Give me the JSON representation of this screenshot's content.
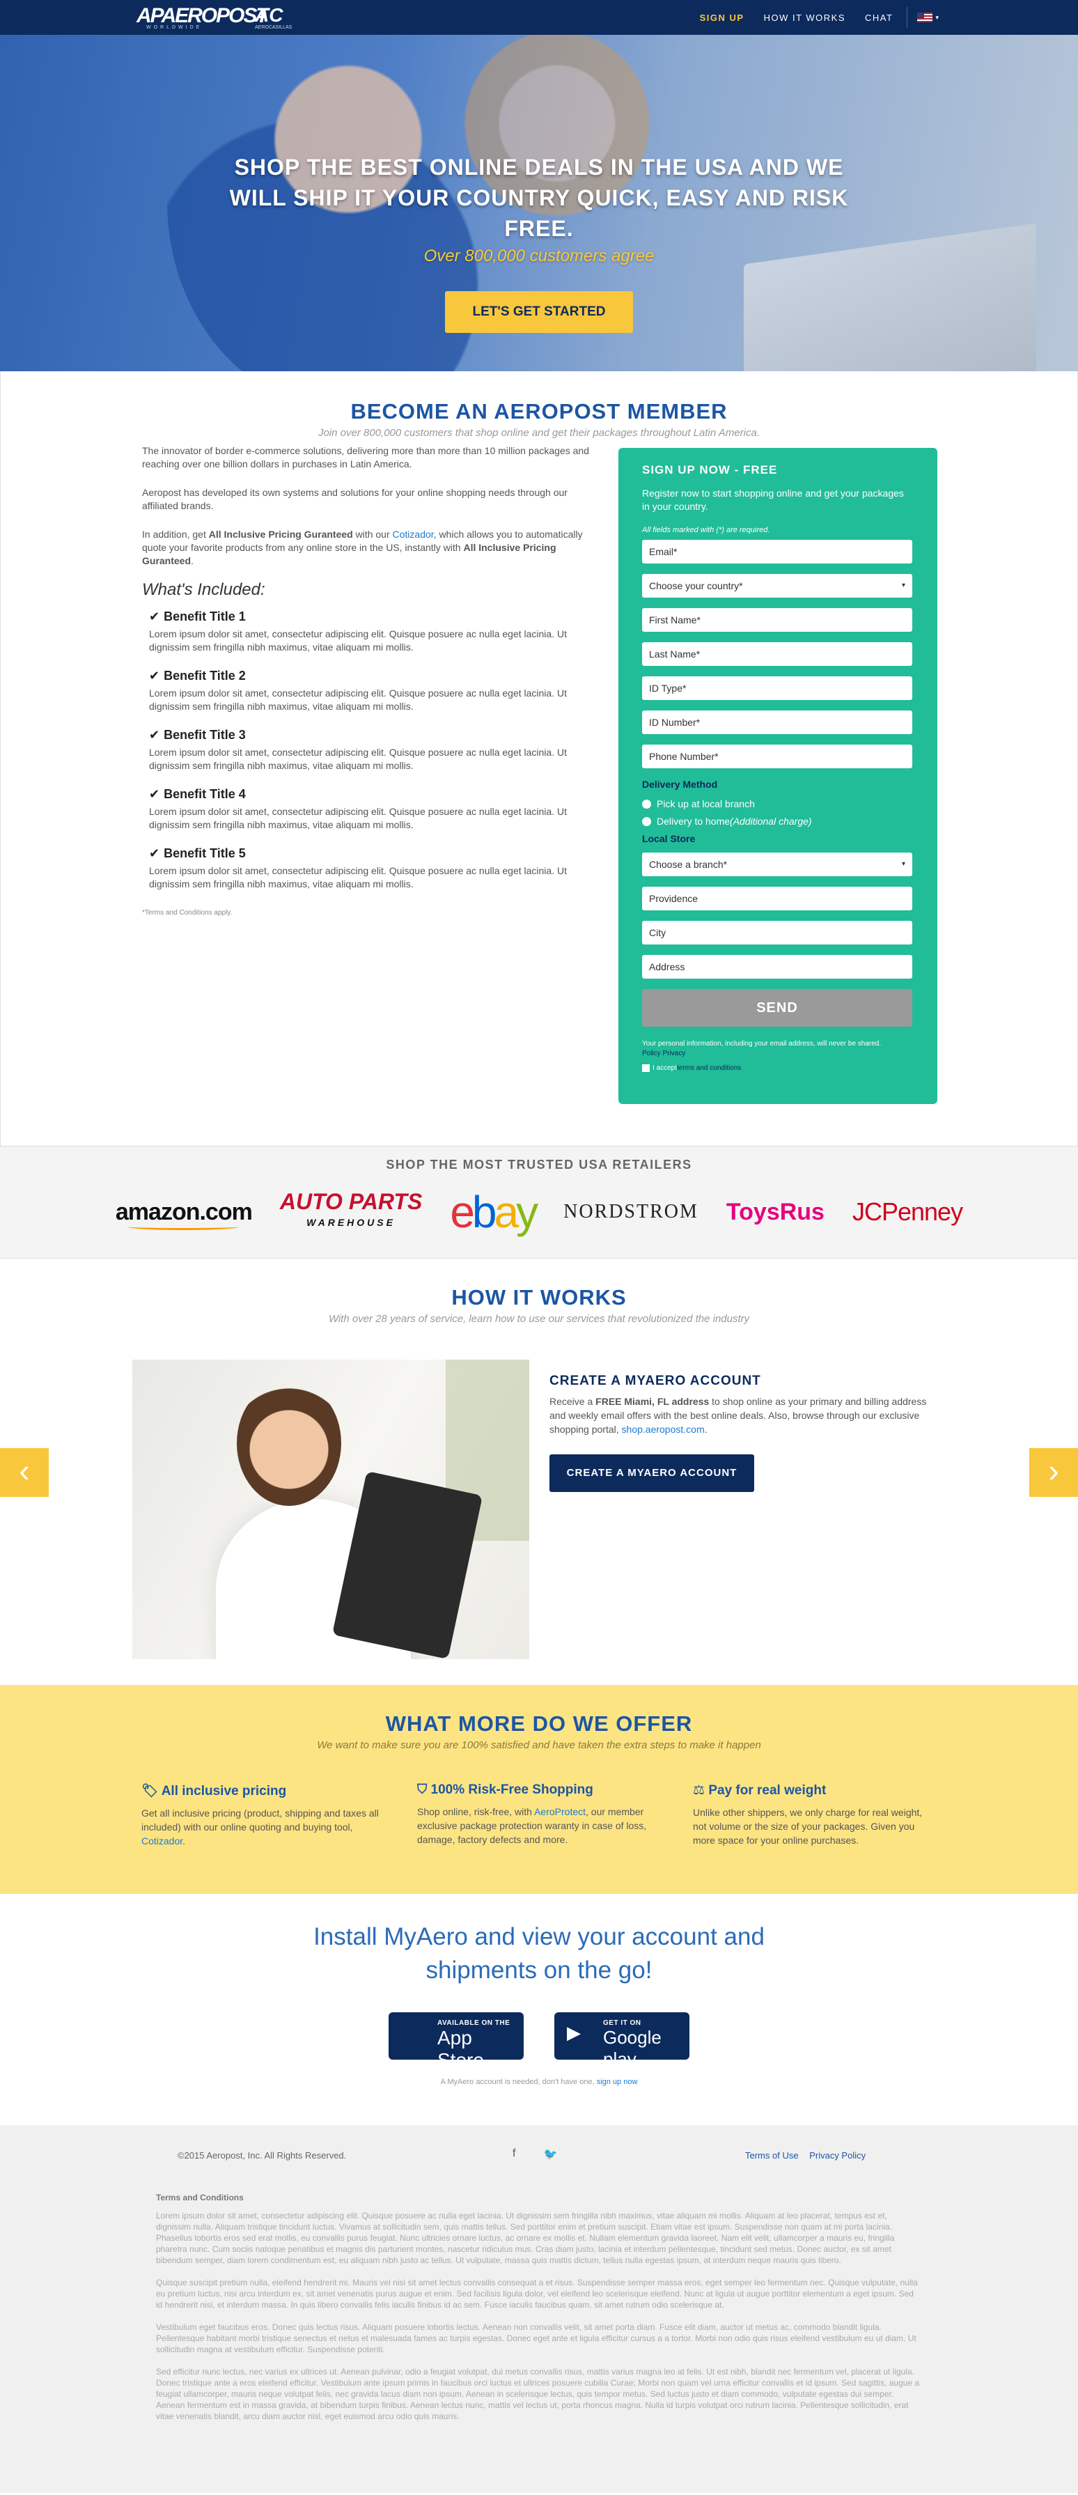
{
  "nav": {
    "logo_main": "AEROPOST",
    "logo_mark": "AP",
    "logo_sub": "WORLDWIDE",
    "logo_ac": "AC",
    "logo_ac_sub": "AEROCASILLAS",
    "signup": "SIGN UP",
    "how": "HOW IT WORKS",
    "chat": "CHAT",
    "caret": "▾"
  },
  "hero": {
    "headline": "SHOP THE BEST ONLINE DEALS IN THE USA AND WE WILL SHIP IT YOUR COUNTRY QUICK, EASY AND RISK FREE.",
    "tagline": "Over 800,000 customers agree",
    "cta": "LET'S GET STARTED"
  },
  "member": {
    "title": "BECOME AN AEROPOST MEMBER",
    "subtitle": "Join over 800,000 customers that shop online and get their packages throughout Latin America.",
    "p1": "The innovator of border e-commerce solutions, delivering more than more than 10 million packages and reaching over one billion dollars in purchases in Latin America.",
    "p2": "Aeropost has developed its own systems and solutions for your online shopping needs through our affiliated brands.",
    "p3_a": "In addition, get ",
    "p3_b": "All Inclusive Pricing Guranteed",
    "p3_c": " with our ",
    "p3_link": "Cotizador",
    "p3_d": ", which allows you to automatically quote your favorite products from any online store in the US, instantly with ",
    "p3_e": "All Inclusive Pricing Guranteed",
    "p3_f": ".",
    "included": "What's Included:",
    "benefits": [
      {
        "title": "Benefit Title 1",
        "text": "Lorem ipsum dolor sit amet, consectetur adipiscing elit. Quisque posuere ac nulla eget lacinia. Ut dignissim sem fringilla nibh maximus, vitae aliquam mi mollis."
      },
      {
        "title": "Benefit Title 2",
        "text": "Lorem ipsum dolor sit amet, consectetur adipiscing elit. Quisque posuere ac nulla eget lacinia. Ut dignissim sem fringilla nibh maximus, vitae aliquam mi mollis."
      },
      {
        "title": "Benefit Title 3",
        "text": "Lorem ipsum dolor sit amet, consectetur adipiscing elit. Quisque posuere ac nulla eget lacinia. Ut dignissim sem fringilla nibh maximus, vitae aliquam mi mollis."
      },
      {
        "title": "Benefit Title 4",
        "text": "Lorem ipsum dolor sit amet, consectetur adipiscing elit. Quisque posuere ac nulla eget lacinia. Ut dignissim sem fringilla nibh maximus, vitae aliquam mi mollis."
      },
      {
        "title": "Benefit Title 5",
        "text": "Lorem ipsum dolor sit amet, consectetur adipiscing elit. Quisque posuere ac nulla eget lacinia. Ut dignissim sem fringilla nibh maximus, vitae aliquam mi mollis."
      }
    ],
    "check": "✔",
    "terms": "*Terms and Conditions apply."
  },
  "form": {
    "title": "SIGN UP NOW - FREE",
    "intro": "Register now to start shopping online and get your packages in your country.",
    "required": "All fields marked with (*) are required.",
    "email": "Email*",
    "country": "Choose your country*",
    "first": "First Name*",
    "last": "Last Name*",
    "idtype": "ID Type*",
    "idnum": "ID Number*",
    "phone": "Phone Number*",
    "delivery_label": "Delivery Method",
    "pickup": "Pick up at local branch",
    "home_a": "Delivery to home ",
    "home_b": "(Additional charge)",
    "store_label": "Local Store",
    "branch": "Choose a branch*",
    "providence": "Providence",
    "city": "City",
    "address": "Address",
    "send": "SEND",
    "privacy": "Your personal information, including your email address, will never be shared.",
    "privacy_link": "Policy Privacy",
    "accept_a": "I accept ",
    "accept_link": "terms and conditions",
    "dd": "▾"
  },
  "retailers": {
    "title": "SHOP THE MOST TRUSTED USA RETAILERS",
    "amazon": "amazon.com",
    "autoparts": "AUTO PARTS",
    "autoparts_sub": "WAREHOUSE",
    "ebay": [
      "e",
      "b",
      "a",
      "y"
    ],
    "nordstrom": "NORDSTROM",
    "toys": "ToysRus",
    "jcp": "JCPenney"
  },
  "how": {
    "title": "HOW IT WORKS",
    "subtitle": "With over 28 years of service, learn how to use our services that revolutionized the industry",
    "step_title": "CREATE A MYAERO ACCOUNT",
    "step_a": "Receive a ",
    "step_b": "FREE Miami, FL address",
    "step_c": " to shop online as your primary and billing address and weekly email offers with the best online deals. Also, browse through our exclusive shopping portal, ",
    "step_link": "shop.aeropost.com",
    "step_d": ".",
    "btn": "CREATE A MYAERO ACCOUNT",
    "prev": "‹",
    "next": "›"
  },
  "offer": {
    "title": "WHAT MORE DO WE OFFER",
    "subtitle": "We want to make sure you are 100% satisfied and have taken the extra steps to make it happen",
    "c1_title": "All inclusive pricing",
    "c1_icon": "🏷",
    "c1_text": "Get all inclusive pricing (product, shipping and taxes all included) with our online quoting and buying tool, ",
    "c1_link": "Cotizador",
    "c1_end": ".",
    "c2_title": "100% Risk-Free Shopping",
    "c2_icon": "⛉",
    "c2_a": "Shop online, risk-free, with ",
    "c2_link": "AeroProtect",
    "c2_b": ", our member exclusive package protection waranty in case of loss, damage, factory defects and more.",
    "c3_title": "Pay for real weight",
    "c3_icon": "⚖",
    "c3_text": "Unlike other shippers, we only charge for real weight, not volume or the size of your packages. Given you more space for your online purchases."
  },
  "app": {
    "title": "Install MyAero and view your account and shipments on the go!",
    "ios_small": "AVAILABLE ON THE",
    "ios_big": "App Store",
    "ios_icon": "",
    "gp_small": "GET IT ON",
    "gp_big": "Google play",
    "gp_icon": "▶",
    "note_a": "A MyAero account is needed, don't have one, ",
    "note_link": "sign up now"
  },
  "footer": {
    "copy": "©2015 Aeropost, Inc. All Rights Reserved.",
    "fb": "f",
    "tw": "🐦",
    "terms": "Terms of Use",
    "privacy": "Privacy Policy",
    "legal_title": "Terms and Conditions",
    "legal": [
      "Lorem ipsum dolor sit amet, consectetur adipiscing elit. Quisque posuere ac nulla eget lacinia. Ut dignissim sem fringilla nibh maximus, vitae aliquam mi mollis. Aliquam at leo placerat, tempus est et, dignissim nulla. Aliquam tristique tincidunt luctus. Vivamus at sollicitudin sem, quis mattis tellus. Sed porttitor enim et pretium suscipit. Etiam vitae est ipsum. Suspendisse non quam at mi porta lacinia. Phasellus lobortis eros sed erat mollis, eu convallis purus feugiat. Nunc ultricies ornare luctus, ac ornare ex mollis et. Nullam elementum gravida laoreet. Nam elit velit, ullamcorper a mauris eu, fringilla pharetra nunc. Cum sociis natoque penatibus et magnis dis parturient montes, nascetur ridiculus mus. Cras diam justo, lacinia et interdum pellentesque, tincidunt sed metus. Donec auctor, ex sit amet bibendum semper, diam lorem condimentum est, eu aliquam nibh justo ac tellus. Ut vulputate, massa quis mattis dictum, tellus nulla egestas ipsum, at interdum neque mauris quis libero.",
      "Quisque suscipit pretium nulla, eleifend hendrerit mi. Mauris vel nisi sit amet lectus convallis consequat a et risus. Suspendisse semper massa eros, eget semper leo fermentum nec. Quisque vulputate, nulla eu pretium luctus, nisi arcu interdum ex, sit amet venenatis purus augue et enim. Sed facilisis ligula dolor, vel eleifend leo scelerisque eleifend. Nunc at ligula ut augue porttitor elementum a eget ipsum. Sed id hendrerit nisi, et interdum massa. In quis libero convallis felis iaculis finibus id ac sem. Fusce iaculis faucibus quam, sit amet rutrum odio scelerisque at.",
      "Vestibulum eget faucibus eros. Donec quis lectus risus. Aliquam posuere lobortis lectus. Aenean non convallis velit, sit amet porta diam. Fusce elit diam, auctor ut metus ac, commodo blandit ligula. Pellentesque habitant morbi tristique senectus et netus et malesuada fames ac turpis egestas. Donec eget ante et ligula efficitur cursus a a tortor. Morbi non odio quis risus eleifend vestibulum eu ut diam. Ut sollicitudin magna at vestibulum efficitur. Suspendisse potenti.",
      "Sed efficitur nunc lectus, nec varius ex ultrices ut. Aenean pulvinar, odio a feugiat volutpat, dui metus convallis risus, mattis varius magna leo at felis. Ut est nibh, blandit nec fermentum vel, placerat ut ligula. Donec tristique ante a eros eleifend efficitur. Vestibulum ante ipsum primis in faucibus orci luctus et ultrices posuere cubilia Curae; Morbi non quam vel urna efficitur convallis et id ipsum. Sed sagittis, augue a feugiat ullamcorper, mauris neque volutpat felis, nec gravida lacus diam non ipsum. Aenean in scelerisque lectus, quis tempor metus. Sed luctus justo et diam commodo, vulputate egestas dui semper. Aenean fermentum est in massa gravida, at bibendum turpis finibus. Aenean lectus nunc, mattis vel lectus ut, porta rhoncus magna. Nulla id turpis volutpat orci rutrum lacinia. Pellentesque sollicitudin, erat vitae venenatis blandit, arcu diam auctor nisl, eget euismod arcu odio quis mauris."
    ]
  },
  "colors": {
    "navy": "#0c2a5c",
    "accent_yellow": "#f9c73c",
    "form_green": "#21bc98",
    "title_blue": "#1c56a3",
    "offer_bg": "#fde483"
  }
}
